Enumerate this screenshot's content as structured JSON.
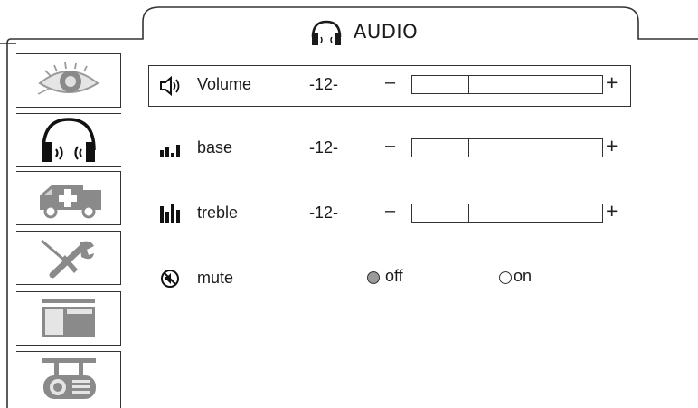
{
  "window": {
    "title": "AUDIO",
    "title_icon": "headphones-icon"
  },
  "sidebar": {
    "items": [
      {
        "id": "picture",
        "icon": "eye-icon"
      },
      {
        "id": "audio",
        "icon": "headphones-icon",
        "active": true
      },
      {
        "id": "emergency",
        "icon": "ambulance-icon"
      },
      {
        "id": "setup",
        "icon": "tools-icon"
      },
      {
        "id": "layout",
        "icon": "window-layout-icon"
      },
      {
        "id": "projector",
        "icon": "ceiling-projector-icon"
      }
    ]
  },
  "settings": {
    "volume": {
      "label": "Volume",
      "value": "-12-",
      "icon": "speaker-icon",
      "level": 0.3,
      "minus": "–",
      "plus": "+"
    },
    "base": {
      "label": "base",
      "value": "-12-",
      "icon": "bass-bars-icon",
      "level": 0.3,
      "minus": "–",
      "plus": "+"
    },
    "treble": {
      "label": "treble",
      "value": "-12-",
      "icon": "treble-bars-icon",
      "level": 0.3,
      "minus": "–",
      "plus": "+"
    },
    "mute": {
      "label": "mute",
      "icon": "mute-icon",
      "options": [
        {
          "label": "off",
          "selected": true
        },
        {
          "label": "on",
          "selected": false
        }
      ]
    }
  },
  "colors": {
    "line": "#333333",
    "icon": "#1a1a1a",
    "radio_selected": "#9a9a9a"
  }
}
